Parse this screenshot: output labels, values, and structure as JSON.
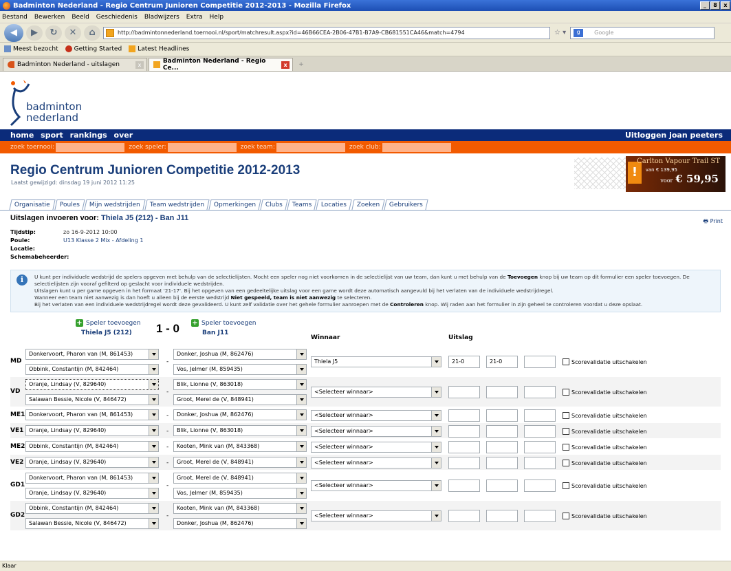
{
  "window": {
    "title": "Badminton Nederland - Regio Centrum Junioren Competitie 2012-2013 - Mozilla Firefox",
    "controls": [
      "_",
      "8",
      "x"
    ]
  },
  "menu": [
    "Bestand",
    "Bewerken",
    "Beeld",
    "Geschiedenis",
    "Bladwijzers",
    "Extra",
    "Help"
  ],
  "nav": {
    "url": "http://badmintonnederland.toernooi.nl/sport/matchresult.aspx?id=46B66CEA-2B06-47B1-B7A9-CB681551CA46&match=4794",
    "search_placeholder": "Google"
  },
  "bookmarks": [
    "Meest bezocht",
    "Getting Started",
    "Latest Headlines"
  ],
  "tabs": [
    {
      "label": "Badminton Nederland - uitslagen"
    },
    {
      "label": "Badminton Nederland - Regio Ce..."
    }
  ],
  "logo": {
    "line1": "badminton",
    "line2": "nederland"
  },
  "sitenav": {
    "left": [
      "home",
      "sport",
      "rankings",
      "over"
    ],
    "right": "Uitloggen joan peeters"
  },
  "searchbar": [
    "zoek toernooi:",
    "zoek speler:",
    "zoek team:",
    "zoek club:"
  ],
  "page": {
    "title": "Regio Centrum Junioren Competitie 2012-2013",
    "last_modified": "Laatst gewijzigd: dinsdag 19 juni 2012 11:25"
  },
  "ad": {
    "title": "Carlton Vapour Trail ST",
    "old_price": "van € 139,95",
    "voor": "voor",
    "price": "€ 59,95"
  },
  "sitetabs": [
    "Organisatie",
    "Poules",
    "Mijn wedstrijden",
    "Team wedstrijden",
    "Opmerkingen",
    "Clubs",
    "Teams",
    "Locaties",
    "Zoeken",
    "Gebruikers"
  ],
  "heading": {
    "prefix": "Uitslagen invoeren voor: ",
    "match": "Thiela J5 (212) - Ban J11",
    "print": "Print"
  },
  "meta": [
    {
      "label": "Tijdstip:",
      "value": "zo 16-9-2012 10:00"
    },
    {
      "label": "Poule:",
      "value": "U13 Klasse 2 Mix - Afdeling 1"
    },
    {
      "label": "Locatie:",
      "value": ""
    },
    {
      "label": "Schemabeheerder:",
      "value": ""
    }
  ],
  "info": {
    "l1a": "U kunt per individuele wedstrijd de spelers opgeven met behulp van de selectielijsten. Mocht een speler nog niet voorkomen in de selectielijst van uw team, dan kunt u met behulp van de ",
    "l1b": "Toevoegen",
    "l1c": " knop bij uw team op dit formulier een speler toevoegen. De selectielijsten zijn vooraf gefilterd op geslacht voor individuele wedstrijden.",
    "l2": "Uitslagen kunt u per game opgeven in het formaat '21-17'. Bij het opgeven van een gedeeltelijke uitslag voor een game wordt deze automatisch aangevuld bij het verlaten van de individuele wedstrijdregel.",
    "l3a": "Wanneer een team niet aanwezig is dan hoeft u alleen bij de eerste wedstrijd ",
    "l3b": "Niet gespeeld, team is niet aanwezig",
    "l3c": " te selecteren.",
    "l4a": "Bij het verlaten van een individuele wedstrijdregel wordt deze gevalideerd. U kunt zelf validatie over het gehele formulier aanroepen met de ",
    "l4b": "Controleren",
    "l4c": " knop. Wij raden aan het formulier in zijn geheel te controleren voordat u deze opslaat."
  },
  "form": {
    "add_label": "Speler toevoegen",
    "home_team": "Thiela J5 (212)",
    "away_team": "Ban J11",
    "score": "1 - 0",
    "col_winner": "Winnaar",
    "col_result": "Uitslag",
    "checkbox_label": "Scorevalidatie uitschakelen",
    "rows": [
      {
        "disc": "MD",
        "home": [
          "Donkervoort, Pharon van (M, 861453)",
          "Obbink, Constantijn (M, 842464)"
        ],
        "away": [
          "Donker, Joshua (M, 862476)",
          "Vos, Jelmer (M, 859435)"
        ],
        "winner": "Thiela J5",
        "games": [
          "21-0",
          "21-0",
          ""
        ]
      },
      {
        "disc": "VD",
        "home": [
          "Oranje, Lindsay (V, 829640)",
          "Salawan Bessie, Nicole (V, 846472)"
        ],
        "away": [
          "Blik, Lionne (V, 863018)",
          "Groot, Merel de (V, 848941)"
        ],
        "winner": "<Selecteer winnaar>",
        "games": [
          "",
          "",
          ""
        ]
      },
      {
        "disc": "ME1",
        "home": [
          "Donkervoort, Pharon van (M, 861453)"
        ],
        "away": [
          "Donker, Joshua (M, 862476)"
        ],
        "winner": "<Selecteer winnaar>",
        "games": [
          "",
          "",
          ""
        ]
      },
      {
        "disc": "VE1",
        "home": [
          "Oranje, Lindsay (V, 829640)"
        ],
        "away": [
          "Blik, Lionne (V, 863018)"
        ],
        "winner": "<Selecteer winnaar>",
        "games": [
          "",
          "",
          ""
        ]
      },
      {
        "disc": "ME2",
        "home": [
          "Obbink, Constantijn (M, 842464)"
        ],
        "away": [
          "Kooten, Mink van (M, 843368)"
        ],
        "winner": "<Selecteer winnaar>",
        "games": [
          "",
          "",
          ""
        ]
      },
      {
        "disc": "VE2",
        "home": [
          "Oranje, Lindsay (V, 829640)"
        ],
        "away": [
          "Groot, Merel de (V, 848941)"
        ],
        "winner": "<Selecteer winnaar>",
        "games": [
          "",
          "",
          ""
        ]
      },
      {
        "disc": "GD1",
        "home": [
          "Donkervoort, Pharon van (M, 861453)",
          "Oranje, Lindsay (V, 829640)"
        ],
        "away": [
          "Groot, Merel de (V, 848941)",
          "Vos, Jelmer (M, 859435)"
        ],
        "winner": "<Selecteer winnaar>",
        "games": [
          "",
          "",
          ""
        ]
      },
      {
        "disc": "GD2",
        "home": [
          "Obbink, Constantijn (M, 842464)",
          "Salawan Bessie, Nicole (V, 846472)"
        ],
        "away": [
          "Kooten, Mink van (M, 843368)",
          "Donker, Joshua (M, 862476)"
        ],
        "winner": "<Selecteer winnaar>",
        "games": [
          "",
          "",
          ""
        ]
      }
    ]
  },
  "status": "Klaar",
  "colors": {
    "nav_blue": "#0b2b7a",
    "orange": "#f25a00",
    "title_blue": "#1a3e7a"
  }
}
